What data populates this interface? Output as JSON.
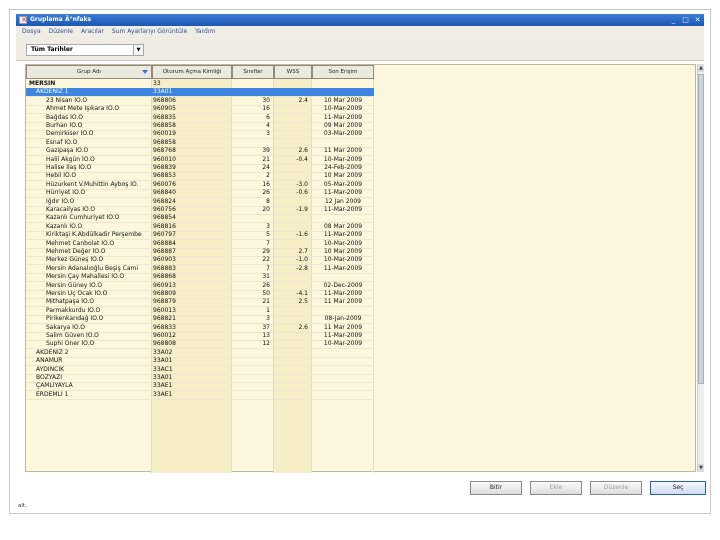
{
  "window": {
    "title": "Gruplama Ä°nfaks",
    "icon": "app-icon",
    "controls": {
      "minimize": "_",
      "maximize": "□",
      "close": "✕"
    }
  },
  "menu": [
    "Dosya",
    "Düzenle",
    "Aracılar",
    "Sum Ayarlarıyı Görüntüle",
    "Yardım"
  ],
  "filter": {
    "date_range": "Tüm Tarihler"
  },
  "table": {
    "columns": [
      "Grup Adı",
      "Oturum Açma Kimliği",
      "Sınıflar",
      "WSS",
      "Son Erişim"
    ],
    "sorted_column": 0,
    "rows": [
      {
        "level": 0,
        "name": "MERSİN",
        "id": "33",
        "classes": "",
        "wss": "",
        "last": ""
      },
      {
        "level": 1,
        "name": "AKDENİZ 1",
        "id": "33A01",
        "classes": "",
        "wss": "",
        "last": "",
        "selected": true
      },
      {
        "level": 2,
        "name": "23 Nisan İÖ.O",
        "id": "968806",
        "classes": "30",
        "wss": "2.4",
        "last": "10 Mar 2009"
      },
      {
        "level": 2,
        "name": "Ahmet Mete Işıkara İÖ.O",
        "id": "960905",
        "classes": "16",
        "wss": "",
        "last": "10-Mar-2009"
      },
      {
        "level": 2,
        "name": "Bağdas İÖ.O",
        "id": "968835",
        "classes": "6",
        "wss": "",
        "last": "11-Mar-2009"
      },
      {
        "level": 2,
        "name": "Burhan İÖ.O",
        "id": "968858",
        "classes": "4",
        "wss": "",
        "last": "09 Mar 2009"
      },
      {
        "level": 2,
        "name": "Demirkiser İÖ.O",
        "id": "960019",
        "classes": "3",
        "wss": "",
        "last": "03-Mar-2009"
      },
      {
        "level": 2,
        "name": "Esnaf İÖ.O",
        "id": "968858",
        "classes": "",
        "wss": "",
        "last": ""
      },
      {
        "level": 2,
        "name": "Gazipaşa İÖ.O",
        "id": "968768",
        "classes": "39",
        "wss": "2.6",
        "last": "11 Mar 2009"
      },
      {
        "level": 2,
        "name": "Halil Akgün İÖ.O",
        "id": "960010",
        "classes": "21",
        "wss": "-0.4",
        "last": "10-Mar-2009"
      },
      {
        "level": 2,
        "name": "Halise Ilaş İÖ.O",
        "id": "968839",
        "classes": "24",
        "wss": "",
        "last": "24-Feb-2009"
      },
      {
        "level": 2,
        "name": "Hebil İÖ.O",
        "id": "968853",
        "classes": "2",
        "wss": "",
        "last": "10 Mar 2009"
      },
      {
        "level": 2,
        "name": "Hüzurkent V.Muhittin Ayboş İÖ.",
        "id": "960076",
        "classes": "16",
        "wss": "-3.0",
        "last": "05-Mar-2009"
      },
      {
        "level": 2,
        "name": "Hürriyet İÖ.O",
        "id": "968840",
        "classes": "26",
        "wss": "-0.6",
        "last": "11-Mar-2009"
      },
      {
        "level": 2,
        "name": "Iğdır İÖ.O",
        "id": "968824",
        "classes": "8",
        "wss": "",
        "last": "12 Jan 2009"
      },
      {
        "level": 2,
        "name": "Karacailyas İÖ.O",
        "id": "960756",
        "classes": "20",
        "wss": "-1.9",
        "last": "11-Mar-2009"
      },
      {
        "level": 2,
        "name": "Kazanlı Cumhuriyet İÖ.O",
        "id": "968854",
        "classes": "",
        "wss": "",
        "last": ""
      },
      {
        "level": 2,
        "name": "Kazanlı İÖ.O",
        "id": "968816",
        "classes": "3",
        "wss": "",
        "last": "08 Mar 2009"
      },
      {
        "level": 2,
        "name": "Kiriktaşi K.Abdülkadir Perşembe",
        "id": "960797",
        "classes": "5",
        "wss": "-1.6",
        "last": "11-Mar-2009"
      },
      {
        "level": 2,
        "name": "Mehmet Canbolat İÖ.O",
        "id": "968884",
        "classes": "7",
        "wss": "",
        "last": "10-Mar-2009"
      },
      {
        "level": 2,
        "name": "Mehmet Değer İÖ.O",
        "id": "968887",
        "classes": "29",
        "wss": "2.7",
        "last": "10 Mar 2009"
      },
      {
        "level": 2,
        "name": "Merkez Güneş İÖ.O",
        "id": "960903",
        "classes": "22",
        "wss": "-1.0",
        "last": "10-Mar-2009"
      },
      {
        "level": 2,
        "name": "Mersin Adanalıoğlu Beşiş Cami",
        "id": "968883",
        "classes": "7",
        "wss": "-2.8",
        "last": "11-Mar-2009"
      },
      {
        "level": 2,
        "name": "Mersin Çay Mahallesi İÖ.O",
        "id": "968868",
        "classes": "31",
        "wss": "",
        "last": ""
      },
      {
        "level": 2,
        "name": "Mersin Güney İÖ.O",
        "id": "960913",
        "classes": "26",
        "wss": "",
        "last": "02-Dec-2009"
      },
      {
        "level": 2,
        "name": "Mersin Üç Ocak İÖ.O",
        "id": "968809",
        "classes": "50",
        "wss": "-4.1",
        "last": "11-Mar-2009"
      },
      {
        "level": 2,
        "name": "Mithatpaşa İÖ.O",
        "id": "968879",
        "classes": "21",
        "wss": "2.5",
        "last": "11 Mar 2009"
      },
      {
        "level": 2,
        "name": "Parmakkurdu İÖ.O",
        "id": "960013",
        "classes": "1",
        "wss": "",
        "last": ""
      },
      {
        "level": 2,
        "name": "Pirikenkarıdağ İÖ.O",
        "id": "968821",
        "classes": "3",
        "wss": "",
        "last": "08-Jan-2009"
      },
      {
        "level": 2,
        "name": "Sakarya İÖ.O",
        "id": "968833",
        "classes": "37",
        "wss": "2.6",
        "last": "11 Mar 2009"
      },
      {
        "level": 2,
        "name": "Salim Güven İÖ.O",
        "id": "960012",
        "classes": "13",
        "wss": "",
        "last": "11-Mar-2009"
      },
      {
        "level": 2,
        "name": "Suphi Öner İÖ.O",
        "id": "968808",
        "classes": "12",
        "wss": "",
        "last": "10-Mar-2009"
      },
      {
        "level": 1,
        "name": "AKDENİZ 2",
        "id": "33A02",
        "classes": "",
        "wss": "",
        "last": ""
      },
      {
        "level": 1,
        "name": "ANAMUR",
        "id": "33A01",
        "classes": "",
        "wss": "",
        "last": ""
      },
      {
        "level": 1,
        "name": "AYDINCIK",
        "id": "33AC1",
        "classes": "",
        "wss": "",
        "last": ""
      },
      {
        "level": 1,
        "name": "BOZYAZI",
        "id": "33A01",
        "classes": "",
        "wss": "",
        "last": ""
      },
      {
        "level": 1,
        "name": "ÇAMLIYAYLA",
        "id": "33AE1",
        "classes": "",
        "wss": "",
        "last": ""
      },
      {
        "level": 1,
        "name": "ERDEMLİ 1",
        "id": "33AE1",
        "classes": "",
        "wss": "",
        "last": ""
      }
    ]
  },
  "buttons": {
    "save": "Bitir",
    "add": "Ekle",
    "edit": "Düzenle",
    "select": "Seç"
  },
  "status": {
    "text": "alt."
  },
  "colors": {
    "selection": "#3d85e0",
    "grid_bg": "#fcf7dd",
    "titlebar": "#1d57b3"
  }
}
